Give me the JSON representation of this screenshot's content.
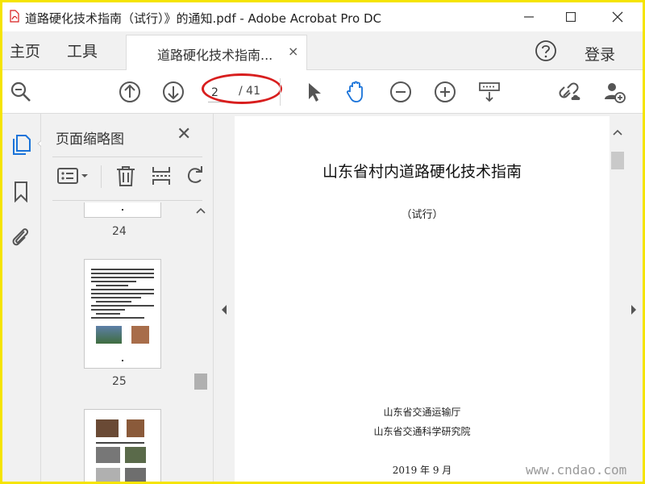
{
  "window": {
    "title": "道路硬化技术指南（试行）》的通知.pdf - Adobe Acrobat Pro DC"
  },
  "menu": {
    "home": "主页",
    "tools": "工具",
    "login": "登录"
  },
  "tab": {
    "label": "道路硬化技术指南...",
    "close": "×"
  },
  "toolbar": {
    "page_current": "2",
    "page_total": "/ 41",
    "icons": [
      "search-icon",
      "page-up-icon",
      "page-down-icon",
      "select-pointer-icon",
      "hand-tool-icon",
      "zoom-out-icon",
      "zoom-in-icon",
      "keyboard-fit-icon",
      "share-link-icon",
      "add-user-icon"
    ]
  },
  "panel": {
    "title": "页面缩略图",
    "close": "✕",
    "thumbs": [
      "24",
      "25"
    ]
  },
  "document": {
    "title": "山东省村内道路硬化技术指南",
    "subtitle": "（试行）",
    "org1": "山东省交通运输厅",
    "org2": "山东省交通科学研究院",
    "date": "2019 年 9 月"
  },
  "watermark": "www.cndao.com",
  "colors": {
    "frame": "#f5e400",
    "acrobat_red": "#d81e1e",
    "hand_active": "#1a73d9",
    "icon_gray": "#555555"
  }
}
